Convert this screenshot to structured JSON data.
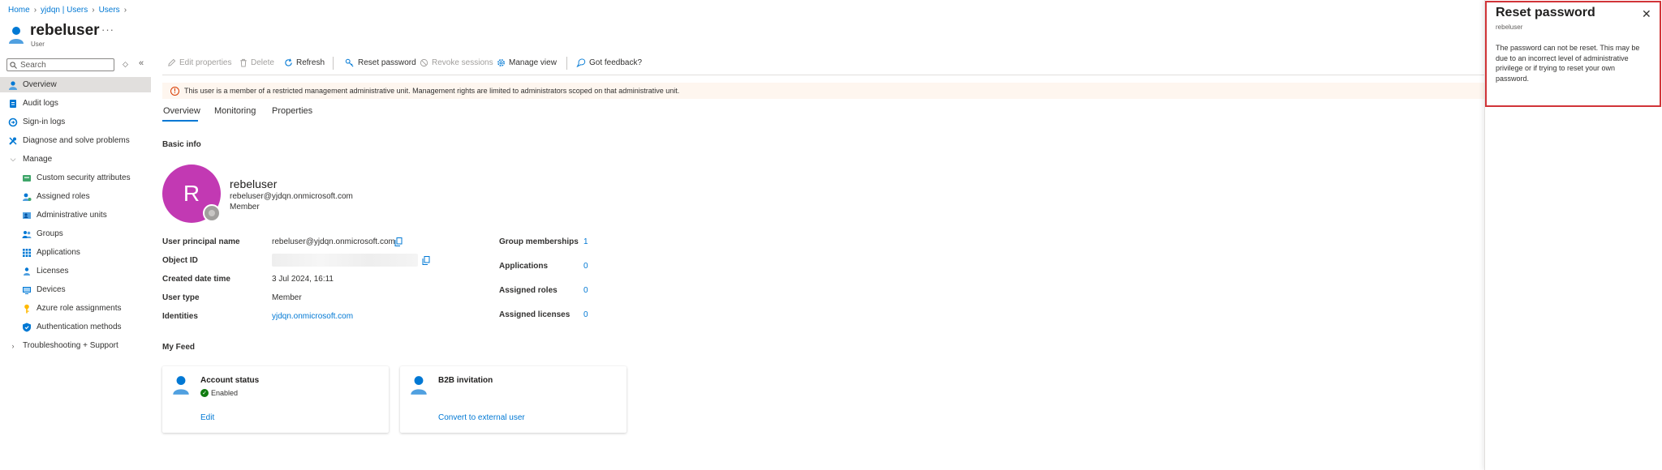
{
  "breadcrumb": [
    "Home",
    "yjdqn | Users",
    "Users"
  ],
  "header": {
    "title": "rebeluser",
    "subtitle": "User",
    "more": "···"
  },
  "sidebar": {
    "search_placeholder": "Search",
    "misc_label": "◇",
    "collapse_label": "«",
    "items": [
      {
        "label": "Overview",
        "icon": "user-icon",
        "active": true
      },
      {
        "label": "Audit logs",
        "icon": "log-icon"
      },
      {
        "label": "Sign-in logs",
        "icon": "signin-icon"
      },
      {
        "label": "Diagnose and solve problems",
        "icon": "wrench-icon"
      },
      {
        "label": "Manage",
        "icon": "chevron-down-icon",
        "group": true
      },
      {
        "label": "Custom security attributes",
        "icon": "tag-icon"
      },
      {
        "label": "Assigned roles",
        "icon": "roles-icon"
      },
      {
        "label": "Administrative units",
        "icon": "admin-units-icon"
      },
      {
        "label": "Groups",
        "icon": "groups-icon"
      },
      {
        "label": "Applications",
        "icon": "apps-grid-icon"
      },
      {
        "label": "Licenses",
        "icon": "license-icon"
      },
      {
        "label": "Devices",
        "icon": "device-icon"
      },
      {
        "label": "Azure role assignments",
        "icon": "key-icon"
      },
      {
        "label": "Authentication methods",
        "icon": "shield-icon"
      },
      {
        "label": "Troubleshooting + Support",
        "icon": "chevron-right-icon",
        "group": true
      }
    ]
  },
  "toolbar": {
    "edit": "Edit properties",
    "delete": "Delete",
    "refresh": "Refresh",
    "reset": "Reset password",
    "revoke": "Revoke sessions",
    "manage_view": "Manage view",
    "feedback": "Got feedback?"
  },
  "banner": {
    "text": "This user is a member of a restricted management administrative unit. Management rights are limited to administrators scoped on that administrative unit."
  },
  "tabs": [
    "Overview",
    "Monitoring",
    "Properties"
  ],
  "basic_info": {
    "heading": "Basic info",
    "avatar_letter": "R",
    "name": "rebeluser",
    "email": "rebeluser@yjdqn.onmicrosoft.com",
    "member_type": "Member",
    "props": [
      {
        "label": "User principal name",
        "value": "rebeluser@yjdqn.onmicrosoft.com"
      },
      {
        "label": "Object ID",
        "value": ""
      },
      {
        "label": "Created date time",
        "value": "3 Jul 2024, 16:11"
      },
      {
        "label": "User type",
        "value": "Member"
      },
      {
        "label": "Identities",
        "value": "yjdqn.onmicrosoft.com"
      }
    ],
    "stats": [
      {
        "label": "Group memberships",
        "value": "1"
      },
      {
        "label": "Applications",
        "value": "0"
      },
      {
        "label": "Assigned roles",
        "value": "0"
      },
      {
        "label": "Assigned licenses",
        "value": "0"
      }
    ]
  },
  "feed": {
    "heading": "My Feed",
    "cards": [
      {
        "title": "Account status",
        "status": "Enabled",
        "link": "Edit"
      },
      {
        "title": "B2B invitation",
        "status": "",
        "link": "Convert to external user"
      }
    ]
  },
  "panel": {
    "title": "Reset password",
    "subtitle": "rebeluser",
    "close": "✕",
    "message": "The password can not be reset. This may be due to an incorrect level of administrative privilege or if trying to reset your own password."
  },
  "colors": {
    "accent": "#0078d4",
    "avatar": "#c239b3",
    "warning_bg": "#fef6ef",
    "highlight_border": "#d13438",
    "success": "#107c10"
  }
}
